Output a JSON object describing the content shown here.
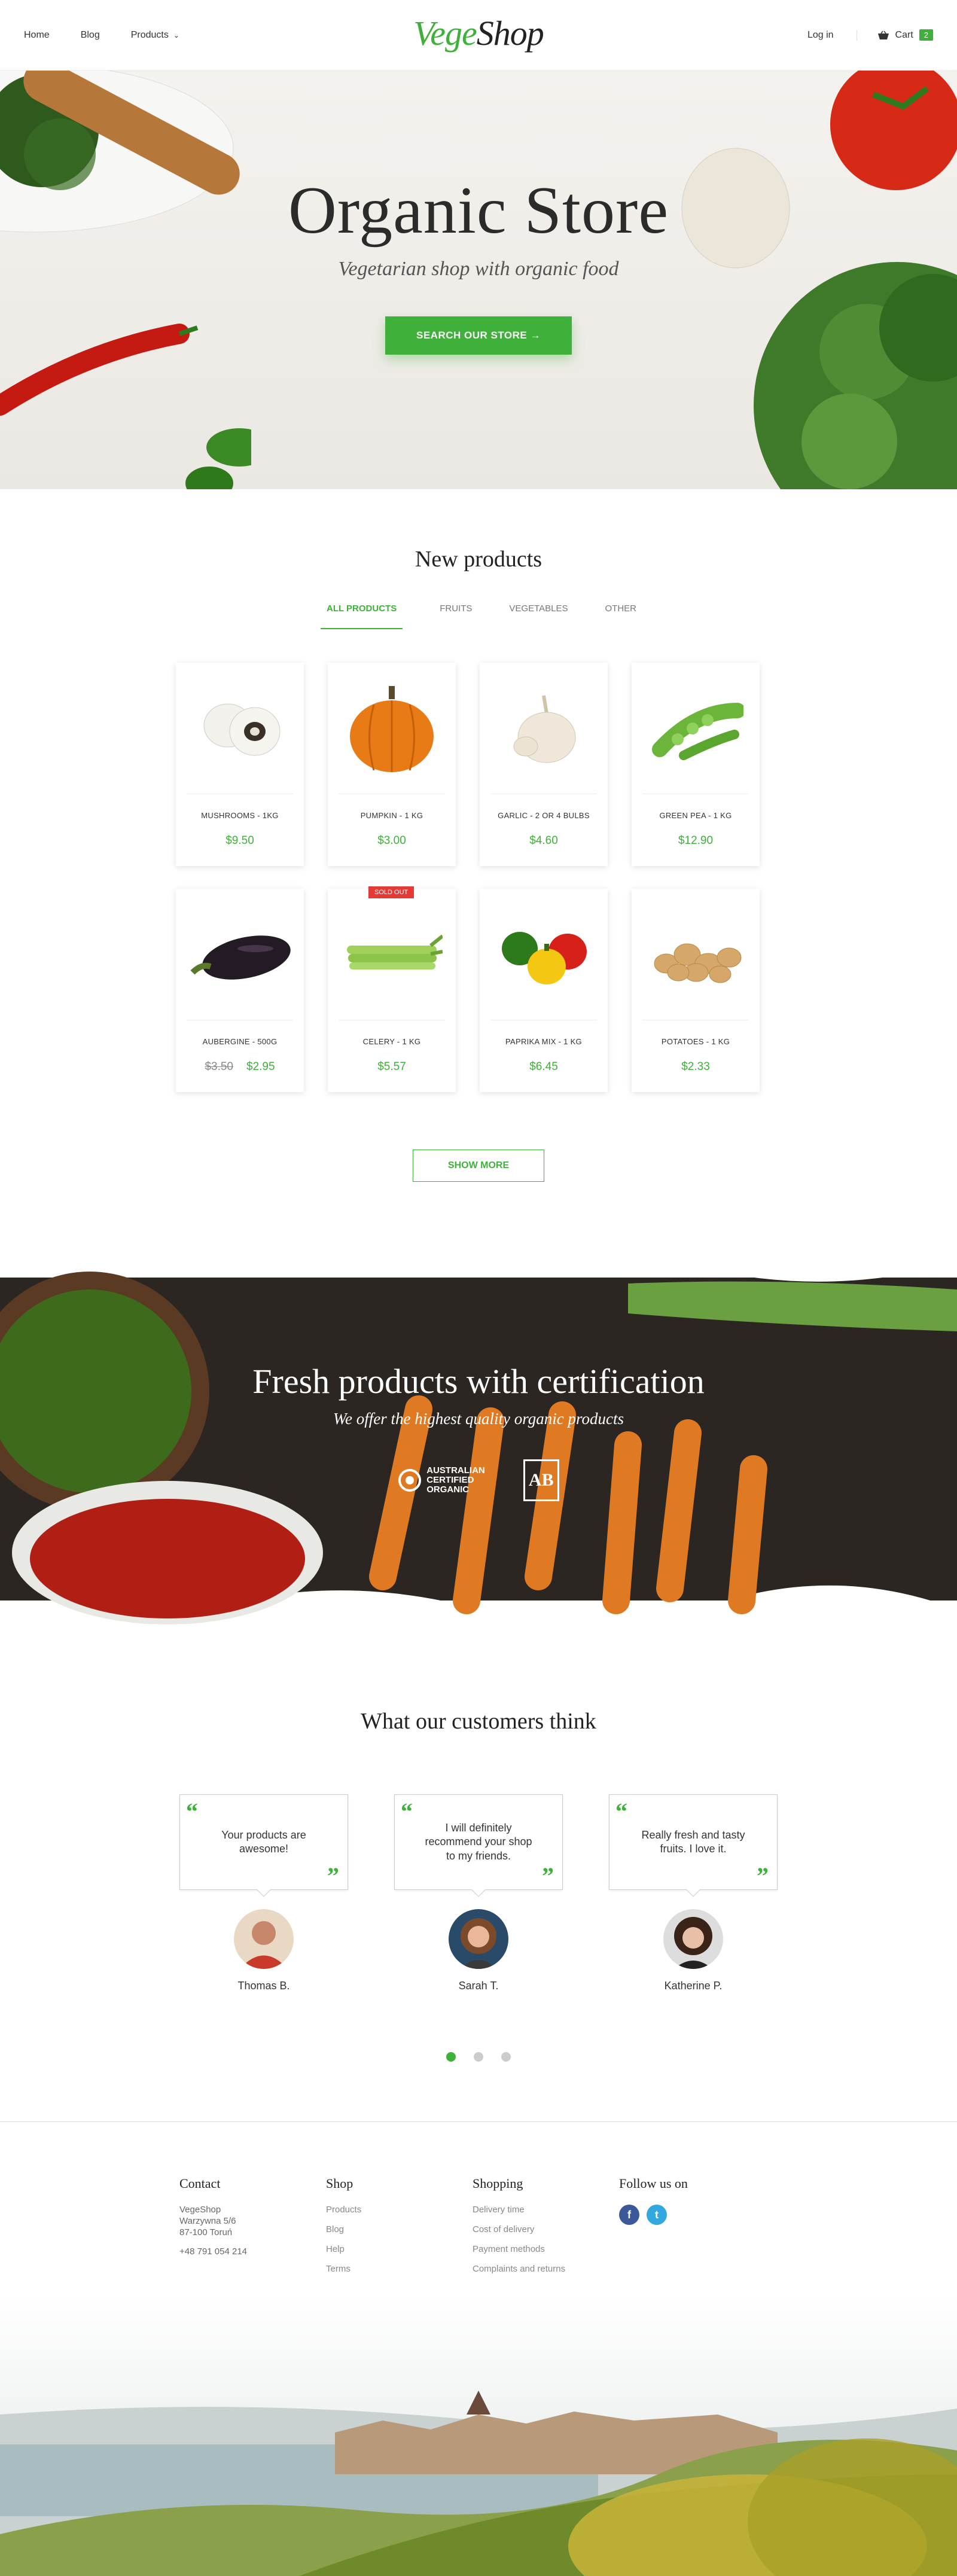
{
  "nav": {
    "links": [
      "Home",
      "Blog",
      "Products"
    ],
    "logo_part1": "Vege",
    "logo_part2": "Shop",
    "login": "Log in",
    "cart_label": "Cart",
    "cart_count": "2"
  },
  "hero": {
    "title": "Organic Store",
    "subtitle": "Vegetarian shop with organic food",
    "button": "SEARCH OUR STORE  →"
  },
  "products": {
    "title": "New products",
    "tabs": [
      "ALL PRODUCTS",
      "FRUITS",
      "VEGETABLES",
      "OTHER"
    ],
    "items": [
      {
        "name": "MUSHROOMS - 1KG",
        "price": "$9.50"
      },
      {
        "name": "PUMPKIN - 1 KG",
        "price": "$3.00"
      },
      {
        "name": "GARLIC - 2 OR 4 BULBS",
        "price": "$4.60"
      },
      {
        "name": "GREEN PEA - 1 KG",
        "price": "$12.90"
      },
      {
        "name": "AUBERGINE - 500G",
        "old_price": "$3.50",
        "price": "$2.95"
      },
      {
        "name": "CELERY - 1 KG",
        "price": "$5.57",
        "badge": "SOLD OUT"
      },
      {
        "name": "PAPRIKA MIX - 1 KG",
        "price": "$6.45"
      },
      {
        "name": "POTATOES - 1 KG",
        "price": "$2.33"
      }
    ],
    "show_more": "SHOW MORE"
  },
  "cert": {
    "title": "Fresh products with certification",
    "subtitle": "We offer the highest quality organic products",
    "logo1_line1": "AUSTRALIAN",
    "logo1_line2": "CERTIFIED",
    "logo1_line3": "ORGANIC",
    "logo2": "AB"
  },
  "testimonials": {
    "title": "What our customers think",
    "items": [
      {
        "text": "Your products are awesome!",
        "name": "Thomas B."
      },
      {
        "text": "I will definitely recommend your shop to my friends.",
        "name": "Sarah T."
      },
      {
        "text": "Really fresh and tasty fruits. I love it.",
        "name": "Katherine P."
      }
    ]
  },
  "footer": {
    "contact": {
      "title": "Contact",
      "line1": "VegeShop",
      "line2": "Warzywna 5/6",
      "line3": "87-100 Toruń",
      "phone": "+48 791 054 214"
    },
    "shop": {
      "title": "Shop",
      "links": [
        "Products",
        "Blog",
        "Help",
        "Terms"
      ]
    },
    "shopping": {
      "title": "Shopping",
      "links": [
        "Delivery time",
        "Cost of delivery",
        "Payment methods",
        "Complaints and returns"
      ]
    },
    "follow": {
      "title": "Follow us on",
      "facebook": "f",
      "twitter": "t"
    }
  },
  "colors": {
    "accent": "#3fb03a",
    "sold_out": "#e53935"
  }
}
